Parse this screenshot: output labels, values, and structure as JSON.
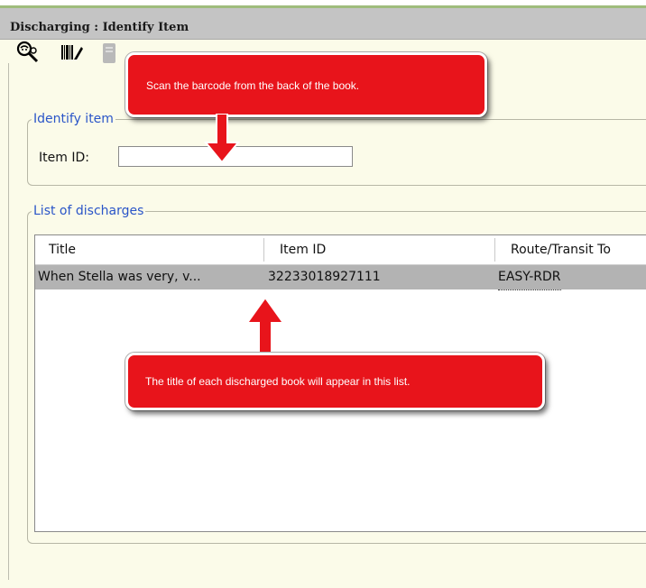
{
  "window": {
    "title": "Discharging : Identify Item"
  },
  "toolbar": {
    "icons": [
      "user-lookup-icon",
      "barcode-scan-icon",
      "disabled-tool-icon"
    ]
  },
  "identify": {
    "legend": "Identify item",
    "item_id_label": "Item ID:",
    "item_id_value": ""
  },
  "discharges": {
    "legend": "List of discharges",
    "columns": [
      "Title",
      "Item ID",
      "Route/Transit To"
    ],
    "rows": [
      {
        "title": "When Stella was very, v...",
        "item_id": "32233018927111",
        "route": "EASY-RDR"
      }
    ]
  },
  "callouts": {
    "top": "Scan the barcode from the back of the book.",
    "bottom": "The title of each discharged book will appear in this list."
  },
  "colors": {
    "callout": "#e8141b",
    "legend": "#2a55c8",
    "panel": "#fbfbe9",
    "selected_row": "#b3b3b3"
  }
}
